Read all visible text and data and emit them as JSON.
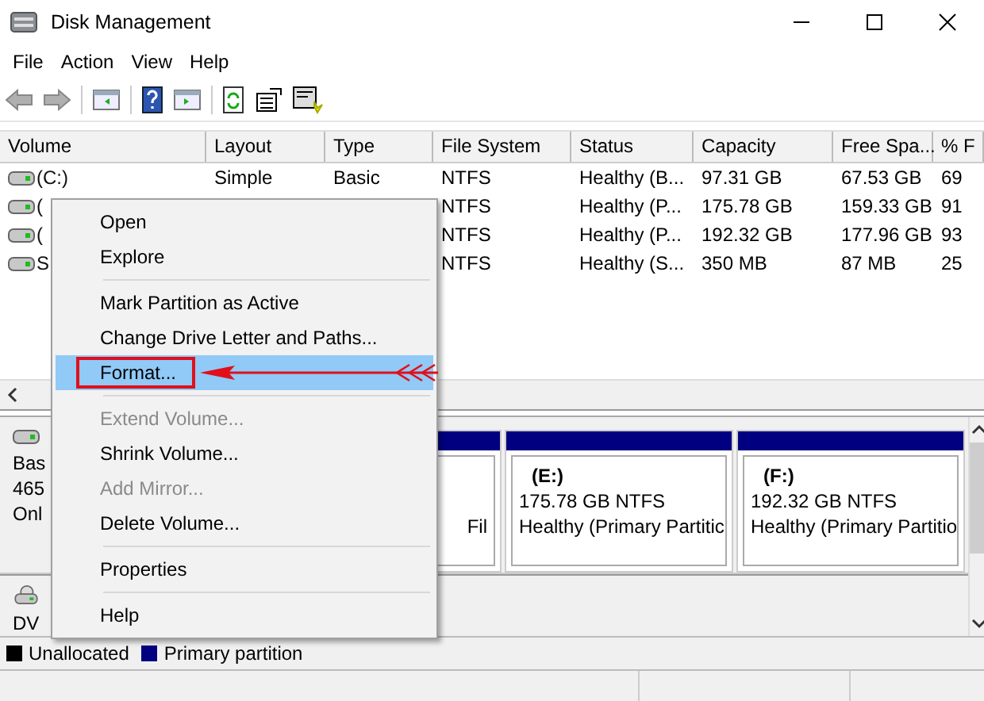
{
  "window": {
    "title": "Disk Management"
  },
  "menu_bar": [
    "File",
    "Action",
    "View",
    "Help"
  ],
  "table": {
    "columns": [
      "Volume",
      "Layout",
      "Type",
      "File System",
      "Status",
      "Capacity",
      "Free Spa...",
      "% F"
    ],
    "rows": [
      {
        "cells": [
          "(C:)",
          "Simple",
          "Basic",
          "NTFS",
          "Healthy (B...",
          "97.31 GB",
          "67.53 GB",
          "69"
        ]
      },
      {
        "cells": [
          "(",
          "",
          "",
          "NTFS",
          "Healthy (P...",
          "175.78 GB",
          "159.33 GB",
          "91"
        ]
      },
      {
        "cells": [
          "(",
          "",
          "",
          "NTFS",
          "Healthy (P...",
          "192.32 GB",
          "177.96 GB",
          "93"
        ]
      },
      {
        "cells": [
          "S",
          "",
          "",
          "NTFS",
          "Healthy (S...",
          "350 MB",
          "87 MB",
          "25"
        ]
      }
    ]
  },
  "disks": [
    {
      "kind": "hdd",
      "lines": [
        "Bas",
        "465",
        "Onl"
      ],
      "partitions": [
        {
          "status": "Fil"
        },
        {
          "name": "(E:)",
          "size": "175.78 GB NTFS",
          "status": "Healthy (Primary Partitic"
        },
        {
          "name": "(F:)",
          "size": "192.32 GB NTFS",
          "status": "Healthy (Primary Partitio"
        }
      ]
    },
    {
      "kind": "dvd",
      "lines": [
        "DV"
      ]
    }
  ],
  "legend": [
    {
      "label": "Unallocated",
      "color": "#000000"
    },
    {
      "label": "Primary partition",
      "color": "#000080"
    }
  ],
  "context_menu": {
    "items": [
      {
        "kind": "item",
        "label": "Open",
        "disabled": false,
        "selected": false
      },
      {
        "kind": "item",
        "label": "Explore",
        "disabled": false,
        "selected": false
      },
      {
        "kind": "separator"
      },
      {
        "kind": "item",
        "label": "Mark Partition as Active",
        "disabled": false,
        "selected": false
      },
      {
        "kind": "item",
        "label": "Change Drive Letter and Paths...",
        "disabled": false,
        "selected": false
      },
      {
        "kind": "item",
        "label": "Format...",
        "disabled": false,
        "selected": true
      },
      {
        "kind": "separator"
      },
      {
        "kind": "item",
        "label": "Extend Volume...",
        "disabled": true,
        "selected": false
      },
      {
        "kind": "item",
        "label": "Shrink Volume...",
        "disabled": false,
        "selected": false
      },
      {
        "kind": "item",
        "label": "Add Mirror...",
        "disabled": true,
        "selected": false
      },
      {
        "kind": "item",
        "label": "Delete Volume...",
        "disabled": false,
        "selected": false
      },
      {
        "kind": "separator"
      },
      {
        "kind": "item",
        "label": "Properties",
        "disabled": false,
        "selected": false
      },
      {
        "kind": "separator"
      },
      {
        "kind": "item",
        "label": "Help",
        "disabled": false,
        "selected": false
      }
    ]
  }
}
